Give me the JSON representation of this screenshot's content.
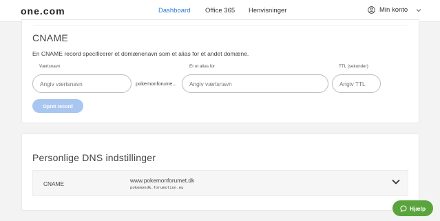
{
  "header": {
    "logo": "one.com",
    "nav": [
      "Dashboard",
      "Office 365",
      "Henvisninger"
    ],
    "account_label": "Min konto"
  },
  "cname": {
    "title": "CNAME",
    "description": "En CNAME record specificerer et domænenavn som et alias for et andet domæne.",
    "hostname_label": "Værtsnavn",
    "hostname_placeholder": "Angiv værtsnavn",
    "domain_suffix": "pokemonforume...",
    "alias_label": "Er et alias for",
    "alias_placeholder": "Angiv værtsnavn",
    "ttl_label": "TTL (sekunder)",
    "ttl_placeholder": "Angiv TTL",
    "create_button": "Opret record"
  },
  "dns_settings": {
    "title": "Personlige DNS indstillinger",
    "record": {
      "type": "CNAME",
      "host": "www.pokemonforumet.dk",
      "target": "pokemondk.forumotion.eu"
    }
  },
  "help": {
    "label": "Hjælp"
  },
  "colors": {
    "accent": "#2b7bd6",
    "button_disabled": "#a8c6ef",
    "help_green": "#5aa43d"
  }
}
